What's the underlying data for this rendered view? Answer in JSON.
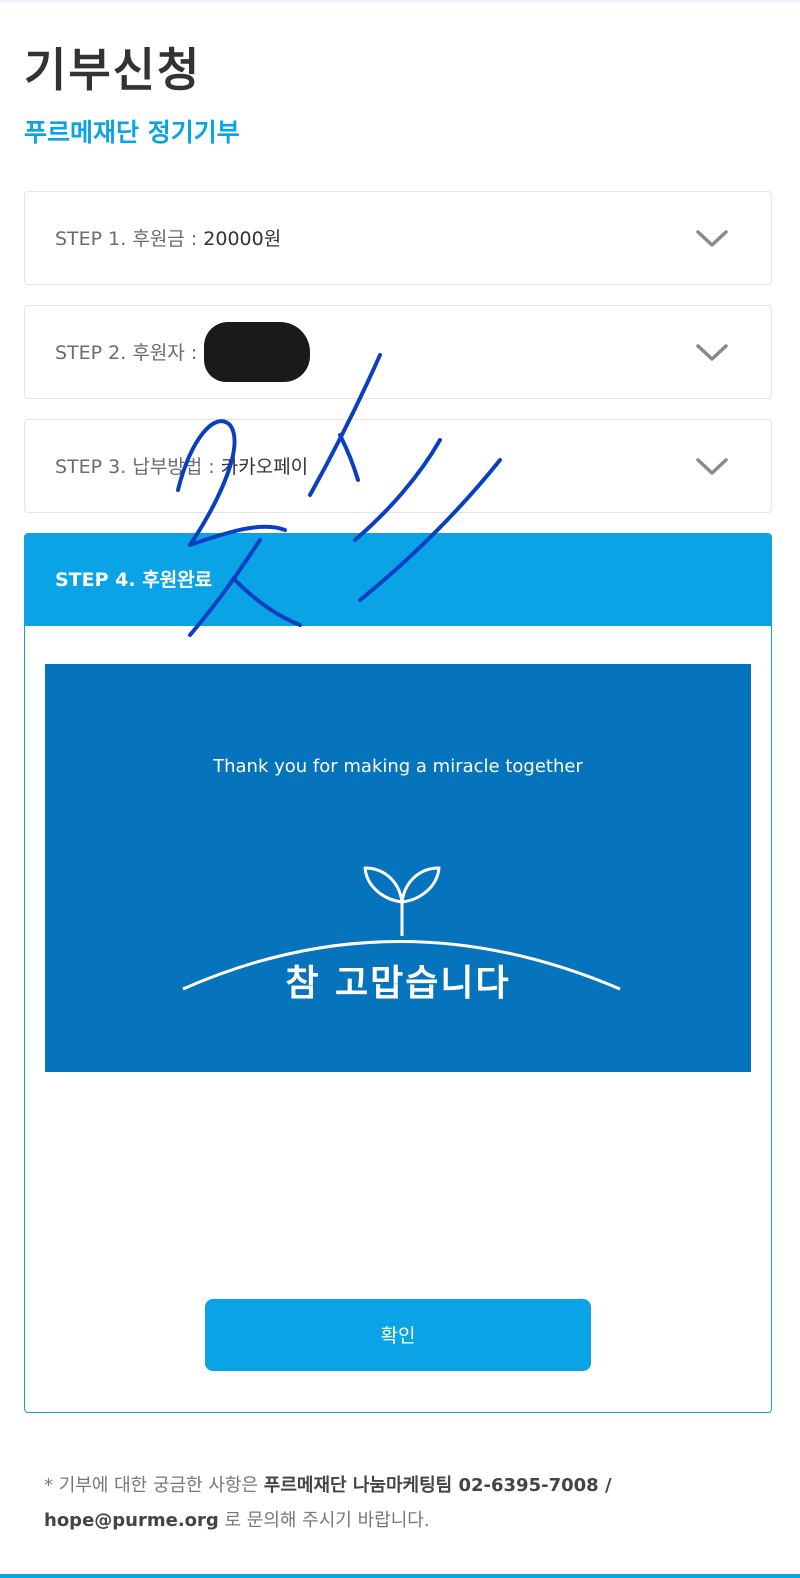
{
  "page": {
    "title": "기부신청",
    "subtitle": "푸르메재단 정기기부"
  },
  "steps": [
    {
      "label": "STEP 1. 후원금 : ",
      "value": "20000원"
    },
    {
      "label": "STEP 2. 후원자 : ",
      "value": ""
    },
    {
      "label": "STEP 3. 납부방법 : ",
      "value": "카카오페이"
    }
  ],
  "step4": {
    "label": "STEP 4. 후원완료",
    "thanks_en": "Thank you for making a miracle together",
    "thanks_ko": "참 고맙습니다",
    "confirm_label": "확인"
  },
  "footer": {
    "prefix": "* 기부에 대한 궁금한 사항은 ",
    "team": "푸르메재단 나눔마케팅팀",
    "contact": " 02-6395-7008 / hope@purme.org",
    "suffix": " 로 문의해 주시기 바랍니다."
  },
  "colors": {
    "accent": "#0aa4e6",
    "card": "#0574bd",
    "title": "#333333"
  },
  "icons": {
    "chevron": "chevron-down-icon",
    "sprout": "sprout-icon"
  }
}
